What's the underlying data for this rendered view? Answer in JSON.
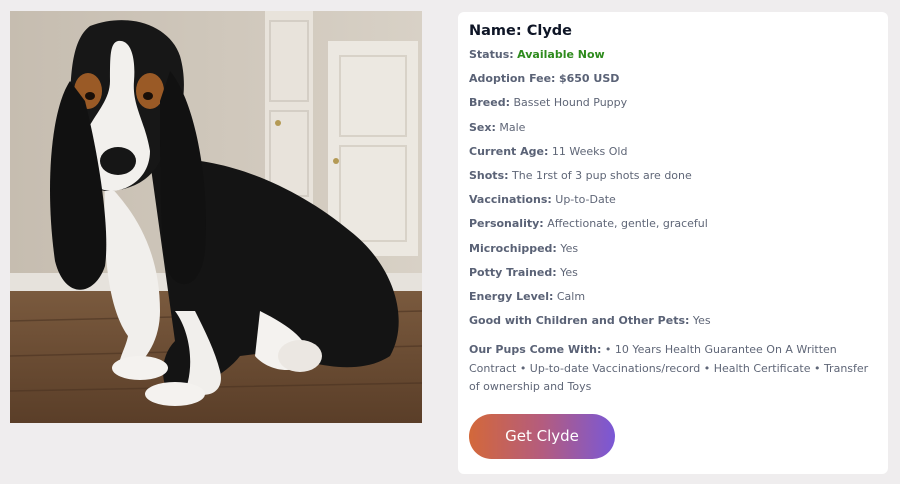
{
  "photo": {
    "subject": "basset-hound-puppy"
  },
  "details": {
    "name_label": "Name:",
    "name_value": "Clyde",
    "rows": [
      {
        "key": "Status:",
        "value": "Available Now"
      },
      {
        "key": "Adoption Fee:",
        "value": "$650 USD"
      },
      {
        "key": "Breed:",
        "value": "Basset Hound Puppy"
      },
      {
        "key": "Sex:",
        "value": "Male"
      },
      {
        "key": "Current Age:",
        "value": "11 Weeks Old"
      },
      {
        "key": "Shots:",
        "value": "The 1rst of 3 pup shots are done"
      },
      {
        "key": "Vaccinations:",
        "value": "Up-to-Date"
      },
      {
        "key": "Personality:",
        "value": "Affectionate, gentle, graceful"
      },
      {
        "key": "Microchipped:",
        "value": "Yes"
      },
      {
        "key": "Potty Trained:",
        "value": "Yes"
      },
      {
        "key": "Energy Level:",
        "value": "Calm"
      },
      {
        "key": "Good with Children and Other Pets:",
        "value": "Yes"
      }
    ],
    "comes_with_label": "Our Pups Come With:",
    "comes_with_text": "• 10 Years Health Guarantee On A Written Contract • Up-to-date Vaccinations/record • Health Certificate • Transfer of ownership and Toys"
  },
  "cta": {
    "label": "Get Clyde"
  },
  "colors": {
    "status_green": "#2e8b1d",
    "cta_gradient_start": "#d3683a",
    "cta_gradient_end": "#7a58d6"
  }
}
